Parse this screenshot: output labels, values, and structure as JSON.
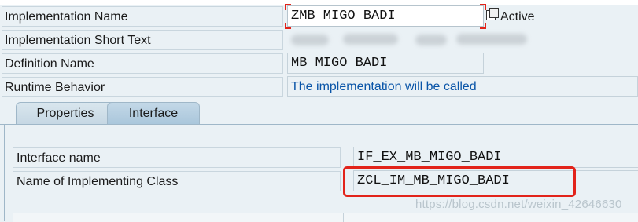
{
  "rows": [
    {
      "label": "Implementation Name",
      "value": "ZMB_MIGO_BADI"
    },
    {
      "label": "Implementation Short Text",
      "value": ""
    },
    {
      "label": "Definition Name",
      "value": "MB_MIGO_BADI"
    },
    {
      "label": "Runtime Behavior",
      "value": "The implementation will be called"
    }
  ],
  "status": "Active",
  "tabs": [
    {
      "label": "Properties",
      "active": false
    },
    {
      "label": "Interface",
      "active": true
    }
  ],
  "interface": {
    "interface_name_label": "Interface name",
    "interface_name_value": "IF_EX_MB_MIGO_BADI",
    "class_label": "Name of Implementing Class",
    "class_value": "ZCL_IM_MB_MIGO_BADI"
  },
  "watermark": "https://blog.csdn.net/weixin_42646630",
  "colors": {
    "highlight": "#e2231a",
    "link_text": "#0a55a8",
    "background": "#eaf1f5"
  },
  "icons": [
    "copy-icon"
  ]
}
